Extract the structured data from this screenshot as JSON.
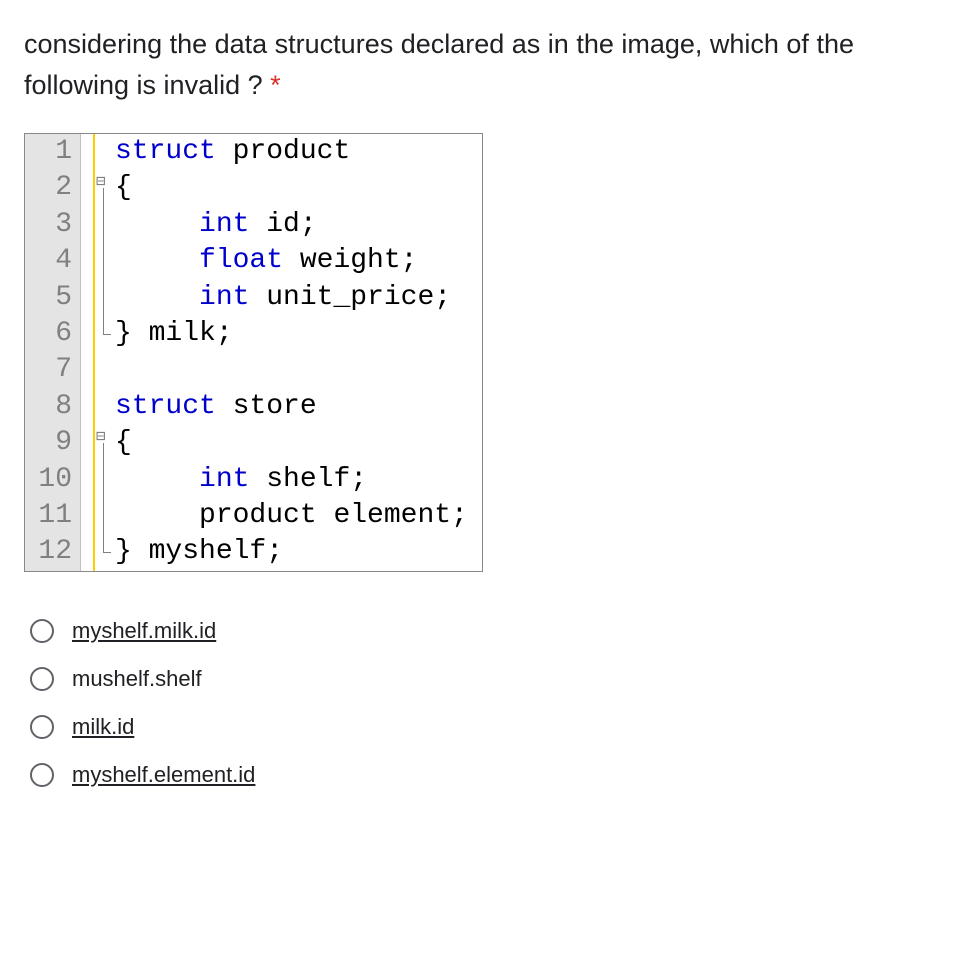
{
  "question": {
    "text": "considering the data structures declared as in the image, which of the following is invalid ?",
    "required": "*"
  },
  "code": {
    "lines": [
      {
        "n": "1",
        "fold": "none",
        "html": "<span class='kw'>struct</span> <span class='id'>product</span>"
      },
      {
        "n": "2",
        "fold": "start",
        "html": "<span class='id'>{</span>"
      },
      {
        "n": "3",
        "fold": "line",
        "html": "     <span class='kw'>int</span> <span class='id'>id;</span>"
      },
      {
        "n": "4",
        "fold": "line",
        "html": "     <span class='kw'>float</span> <span class='id'>weight;</span>"
      },
      {
        "n": "5",
        "fold": "line",
        "html": "     <span class='kw'>int</span> <span class='id'>unit_price;</span>"
      },
      {
        "n": "6",
        "fold": "end",
        "html": "<span class='id'>} milk;</span>"
      },
      {
        "n": "7",
        "fold": "none",
        "html": ""
      },
      {
        "n": "8",
        "fold": "none",
        "html": "<span class='kw'>struct</span> <span class='id'>store</span>"
      },
      {
        "n": "9",
        "fold": "start",
        "html": "<span class='id'>{</span>"
      },
      {
        "n": "10",
        "fold": "line",
        "html": "     <span class='kw'>int</span> <span class='id'>shelf;</span>"
      },
      {
        "n": "11",
        "fold": "line",
        "html": "     <span class='id'>product element;</span>"
      },
      {
        "n": "12",
        "fold": "end",
        "html": "<span class='id'>} myshelf;</span>"
      }
    ]
  },
  "options": [
    {
      "label": "myshelf.milk.id",
      "underlined": true
    },
    {
      "label": "mushelf.shelf",
      "underlined": false
    },
    {
      "label": "milk.id",
      "underlined": true
    },
    {
      "label": "myshelf.element.id",
      "underlined": true
    }
  ]
}
